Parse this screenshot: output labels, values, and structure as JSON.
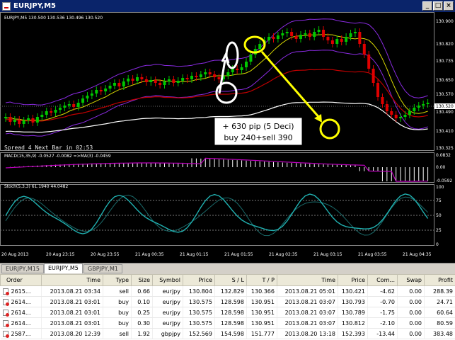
{
  "window": {
    "title": "EURJPY,M5"
  },
  "chart": {
    "header": "EURJPY,M5  130.500 130.536 130.496 130.520",
    "price_labels": [
      "130.900",
      "130.820",
      "130.735",
      "130.650",
      "130.570",
      "130.520",
      "130.490",
      "130.410",
      "130.325"
    ],
    "current_price": "130.520",
    "spread_text": "Spread  4   Next Bar in 02:53",
    "annotation_line1": "+ 630 pip (5 Deci)",
    "annotation_line2": "buy 240+sell 390",
    "macd_label": "MACD(15,35,9) -0.0527 -0.0082 =>MA(3) -0.0459",
    "macd_levels": [
      "0.0832",
      "0.00",
      "-0.0592"
    ],
    "stoch_label": "Stoch(5,3,3) 61.1940 44.0482",
    "stoch_levels": [
      "100",
      "75",
      "50",
      "25",
      "0"
    ],
    "time_labels": [
      "20 Aug 2013",
      "20 Aug 23:15",
      "20 Aug 23:55",
      "21 Aug 00:35",
      "21 Aug 01:15",
      "21 Aug 01:55",
      "21 Aug 02:35",
      "21 Aug 03:15",
      "21 Aug 03:55",
      "21 Aug 04:35"
    ],
    "colors": {
      "bull": "#00c800",
      "bear": "#e00000",
      "bands": "#8a2be2",
      "ma_yellow": "#d8d800",
      "ma_red": "#c00000",
      "ma_white": "#ffffff",
      "ma_green": "#00c000",
      "macd": "#ffffff",
      "signal": "#c000c0",
      "stoch": "#20b0b0",
      "highlight": "#ffff00"
    }
  },
  "tabs": [
    {
      "label": "EURJPY,M15",
      "active": false
    },
    {
      "label": "EURJPY,M5",
      "active": true
    },
    {
      "label": "GBPJPY,M1",
      "active": false
    }
  ],
  "trades": {
    "columns": [
      "Order",
      "Time",
      "Type",
      "Size",
      "Symbol",
      "Price",
      "S / L",
      "T / P",
      "Time",
      "Price",
      "Com...",
      "Swap",
      "Profit"
    ],
    "rows": [
      [
        "2615...",
        "2013.08.21 03:34",
        "sell",
        "0.66",
        "eurjpy",
        "130.804",
        "132.829",
        "130.366",
        "2013.08.21 05:01",
        "130.421",
        "-4.62",
        "0.00",
        "288.39"
      ],
      [
        "2614...",
        "2013.08.21 03:01",
        "buy",
        "0.10",
        "eurjpy",
        "130.575",
        "128.598",
        "130.951",
        "2013.08.21 03:07",
        "130.793",
        "-0.70",
        "0.00",
        "24.71"
      ],
      [
        "2614...",
        "2013.08.21 03:01",
        "buy",
        "0.25",
        "eurjpy",
        "130.575",
        "128.598",
        "130.951",
        "2013.08.21 03:07",
        "130.789",
        "-1.75",
        "0.00",
        "60.64"
      ],
      [
        "2614...",
        "2013.08.21 03:01",
        "buy",
        "0.30",
        "eurjpy",
        "130.575",
        "128.598",
        "130.951",
        "2013.08.21 03:07",
        "130.812",
        "-2.10",
        "0.00",
        "80.59"
      ],
      [
        "2587...",
        "2013.08.20 12:39",
        "sell",
        "1.92",
        "gbpjpy",
        "152.569",
        "154.598",
        "151.777",
        "2013.08.20 13:18",
        "152.393",
        "-13.44",
        "0.00",
        "383.48"
      ]
    ]
  }
}
